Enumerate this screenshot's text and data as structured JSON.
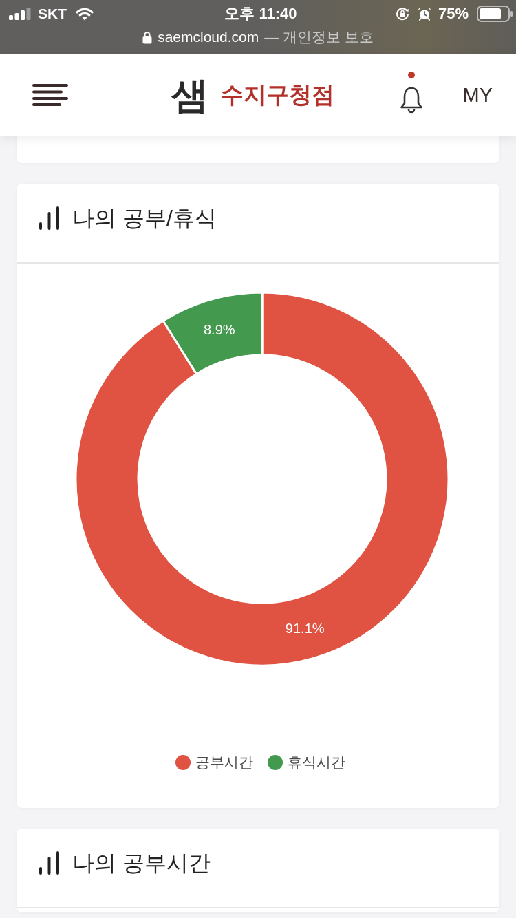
{
  "status_bar": {
    "carrier": "SKT",
    "time": "오후 11:40",
    "battery": "75%"
  },
  "address_bar": {
    "domain": "saemcloud.com",
    "note": "— 개인정보 보호"
  },
  "header": {
    "logo_text": "샘",
    "branch": "수지구청점",
    "notifications": {
      "unread": true
    },
    "my_label": "MY"
  },
  "cards": [
    {
      "kind": "empty"
    },
    {
      "kind": "donut",
      "title": "나의 공부/휴식",
      "chart_data": {
        "type": "donut",
        "categories": [
          "공부시간",
          "휴식시간"
        ],
        "values": [
          91.1,
          8.9
        ],
        "value_labels": [
          "91.1%",
          "8.9%"
        ]
      },
      "legend": [
        {
          "color": "#e05241"
        },
        {
          "color": "#43994e"
        }
      ]
    },
    {
      "kind": "title_only",
      "title": "나의 공부시간"
    }
  ]
}
